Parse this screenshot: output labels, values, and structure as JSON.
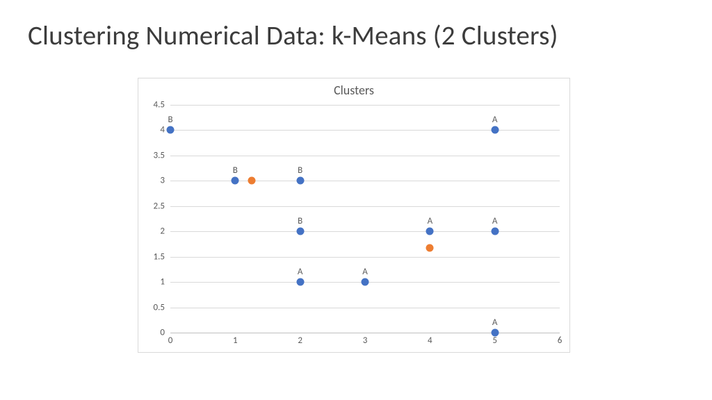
{
  "slide": {
    "title": "Clustering Numerical Data: k-Means (2 Clusters)"
  },
  "chart_data": {
    "type": "scatter",
    "title": "Clusters",
    "xlabel": "",
    "ylabel": "",
    "xlim": [
      0,
      6
    ],
    "ylim": [
      0,
      4.5
    ],
    "xticks": [
      0,
      1,
      2,
      3,
      4,
      5,
      6
    ],
    "yticks": [
      0,
      0.5,
      1,
      1.5,
      2,
      2.5,
      3,
      3.5,
      4,
      4.5
    ],
    "series": [
      {
        "name": "points",
        "color": "#4472c4",
        "points": [
          {
            "x": 0,
            "y": 4,
            "label": "B"
          },
          {
            "x": 1,
            "y": 3,
            "label": "B"
          },
          {
            "x": 2,
            "y": 3,
            "label": "B"
          },
          {
            "x": 2,
            "y": 2,
            "label": "B"
          },
          {
            "x": 2,
            "y": 1,
            "label": "A"
          },
          {
            "x": 3,
            "y": 1,
            "label": "A"
          },
          {
            "x": 4,
            "y": 2,
            "label": "A"
          },
          {
            "x": 5,
            "y": 4,
            "label": "A"
          },
          {
            "x": 5,
            "y": 2,
            "label": "A"
          },
          {
            "x": 5,
            "y": 0,
            "label": "A"
          }
        ]
      },
      {
        "name": "centroids",
        "color": "#ed7d31",
        "points": [
          {
            "x": 1.25,
            "y": 3.0
          },
          {
            "x": 4.0,
            "y": 1.67
          }
        ]
      }
    ]
  }
}
